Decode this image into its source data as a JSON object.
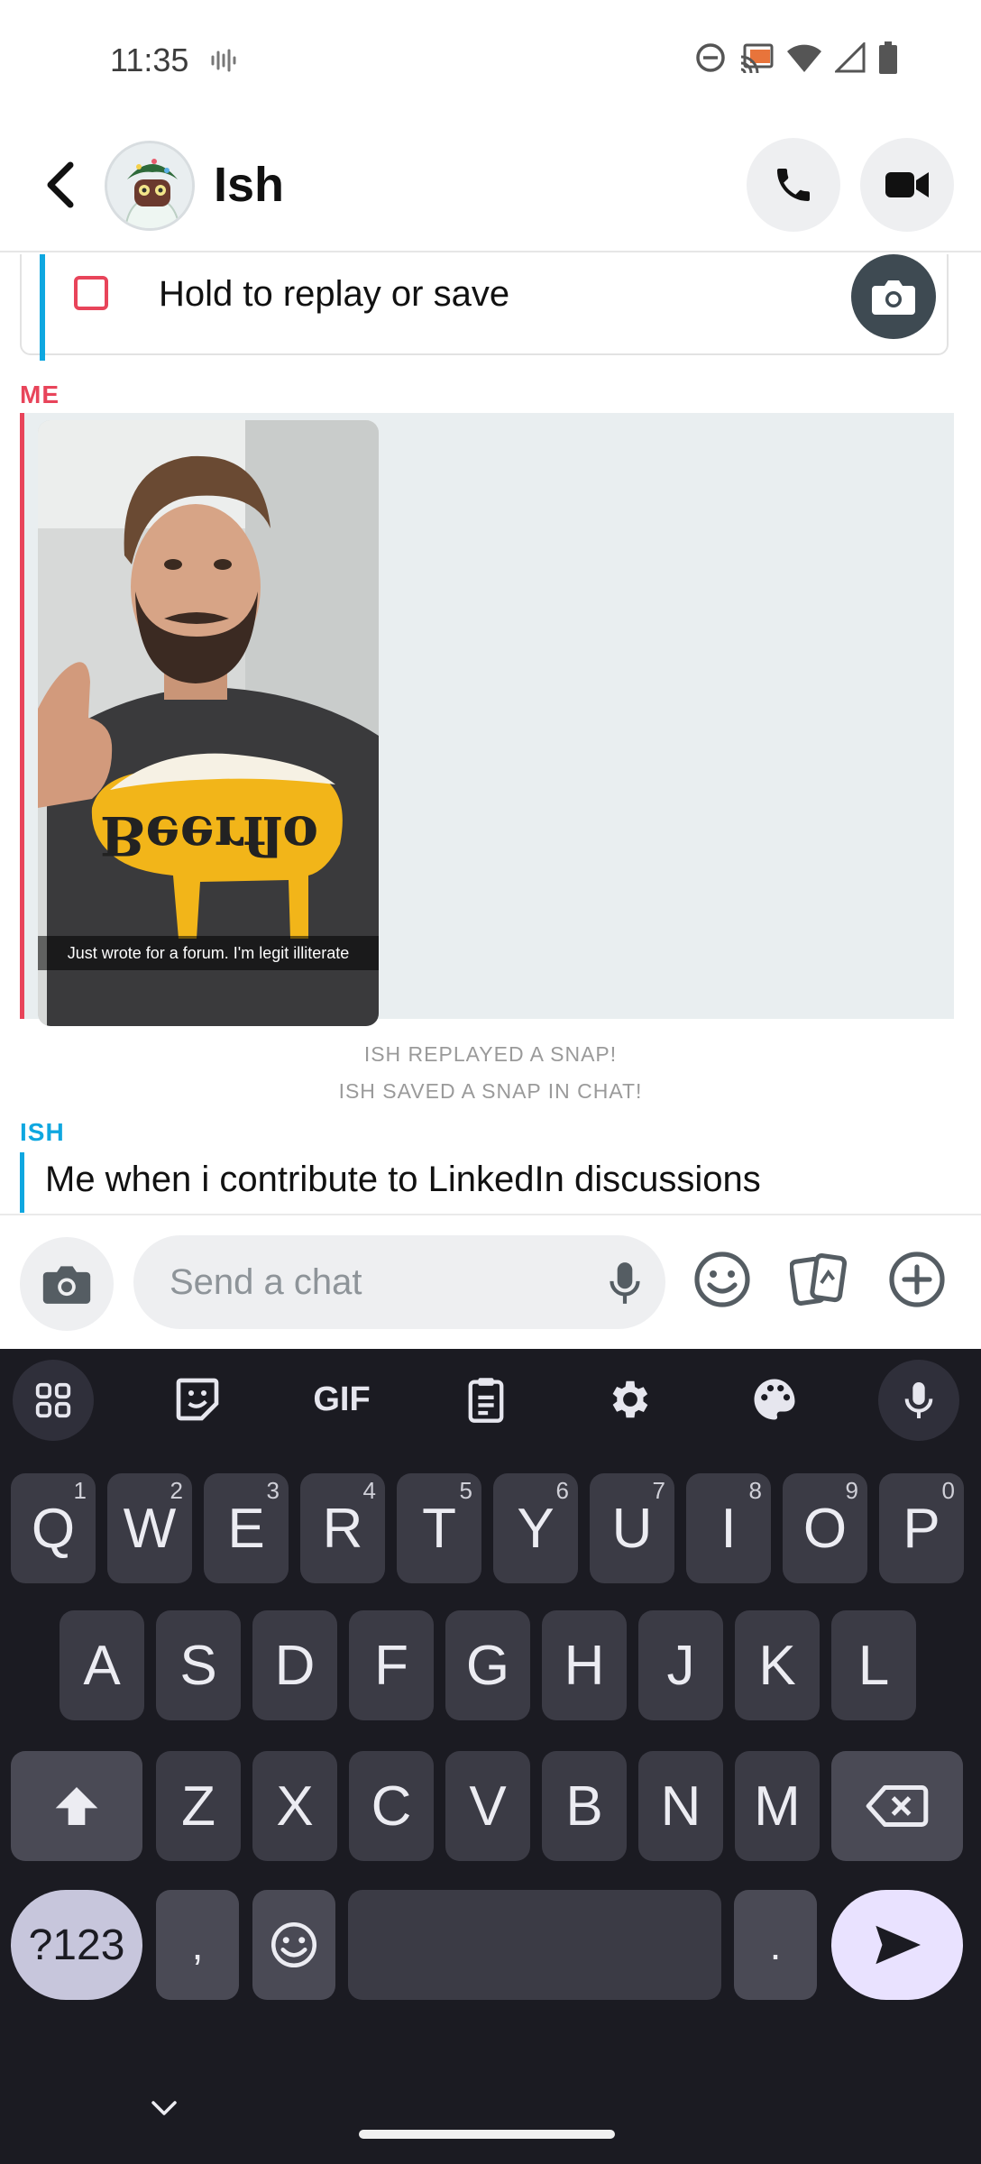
{
  "status_bar": {
    "time": "11:35",
    "icons": [
      "voicemail-wave-icon",
      "do-not-disturb-icon",
      "cast-icon",
      "wifi-icon",
      "signal-icon",
      "battery-icon"
    ]
  },
  "header": {
    "back_icon": "chevron-left-icon",
    "contact_name": "Ish",
    "call_icon": "phone-icon",
    "video_icon": "video-camera-icon"
  },
  "chat": {
    "snap_prompt": "Hold to replay or save",
    "me_label": "ME",
    "snap_caption": "Just wrote for a forum. I'm legit illiterate",
    "snap_shirt_text": "Beerflo",
    "system_messages": [
      "ISH REPLAYED A SNAP!",
      "ISH SAVED A SNAP IN CHAT!"
    ],
    "ish_label": "ISH",
    "ish_message": "Me when i contribute to LinkedIn discussions"
  },
  "composer": {
    "placeholder": "Send a chat",
    "icons": [
      "camera-icon",
      "microphone-icon",
      "emoji-icon",
      "cards-icon",
      "plus-icon"
    ]
  },
  "keyboard": {
    "toolbar_gif": "GIF",
    "toolbar_icons": [
      "apps-grid-icon",
      "sticker-icon",
      "gif-icon",
      "clipboard-icon",
      "settings-icon",
      "palette-icon",
      "voice-input-icon"
    ],
    "row1": [
      {
        "k": "Q",
        "h": "1"
      },
      {
        "k": "W",
        "h": "2"
      },
      {
        "k": "E",
        "h": "3"
      },
      {
        "k": "R",
        "h": "4"
      },
      {
        "k": "T",
        "h": "5"
      },
      {
        "k": "Y",
        "h": "6"
      },
      {
        "k": "U",
        "h": "7"
      },
      {
        "k": "I",
        "h": "8"
      },
      {
        "k": "O",
        "h": "9"
      },
      {
        "k": "P",
        "h": "0"
      }
    ],
    "row2": [
      "A",
      "S",
      "D",
      "F",
      "G",
      "H",
      "J",
      "K",
      "L"
    ],
    "row3": [
      "Z",
      "X",
      "C",
      "V",
      "B",
      "N",
      "M"
    ],
    "symbols_key": "?123",
    "comma_key": ",",
    "period_key": "."
  }
}
